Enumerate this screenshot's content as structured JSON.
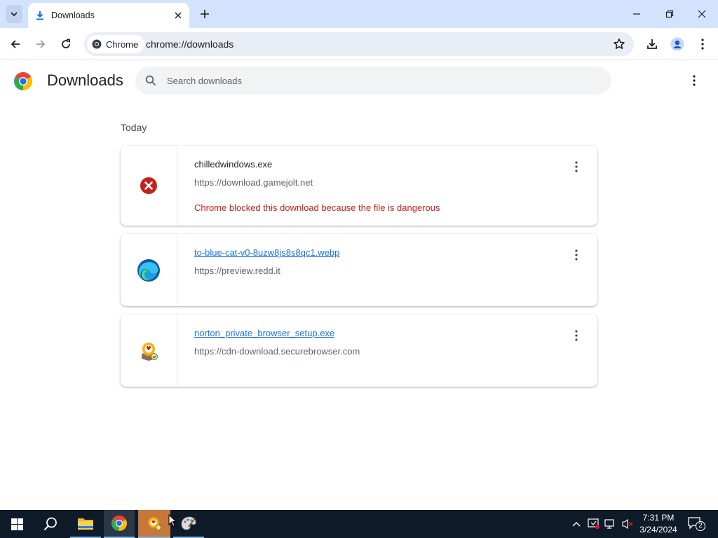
{
  "window": {
    "tab_title": "Downloads",
    "new_tab_symbol": "+"
  },
  "toolbar": {
    "site_chip_label": "Chrome",
    "url": "chrome://downloads"
  },
  "page": {
    "title": "Downloads",
    "search_placeholder": "Search downloads",
    "date_header": "Today"
  },
  "downloads": [
    {
      "filename": "chilledwindows.exe",
      "url": "https://download.gamejolt.net",
      "warning": "Chrome blocked this download because the file is dangerous",
      "icon": "dangerous-x-icon",
      "status_color": "#c5221f"
    },
    {
      "filename": "to-blue-cat-v0-8uzw8js8s8qc1.webp",
      "url": "https://preview.redd.it",
      "icon": "edge-browser-icon"
    },
    {
      "filename": "norton_private_browser_setup.exe",
      "url": "https://cdn-download.securebrowser.com",
      "icon": "norton-installer-icon"
    }
  ],
  "taskbar": {
    "time": "7:31 PM",
    "date": "3/24/2024",
    "notification_count": "2",
    "pinned": [
      "windows-start-icon",
      "search-icon",
      "file-explorer-icon",
      "chrome-icon",
      "norton-setup-icon",
      "paint-icon"
    ]
  },
  "colors": {
    "tabstrip": "#d3e3fd",
    "link": "#1a73e8",
    "danger": "#c5221f",
    "taskbar": "#101b29"
  }
}
